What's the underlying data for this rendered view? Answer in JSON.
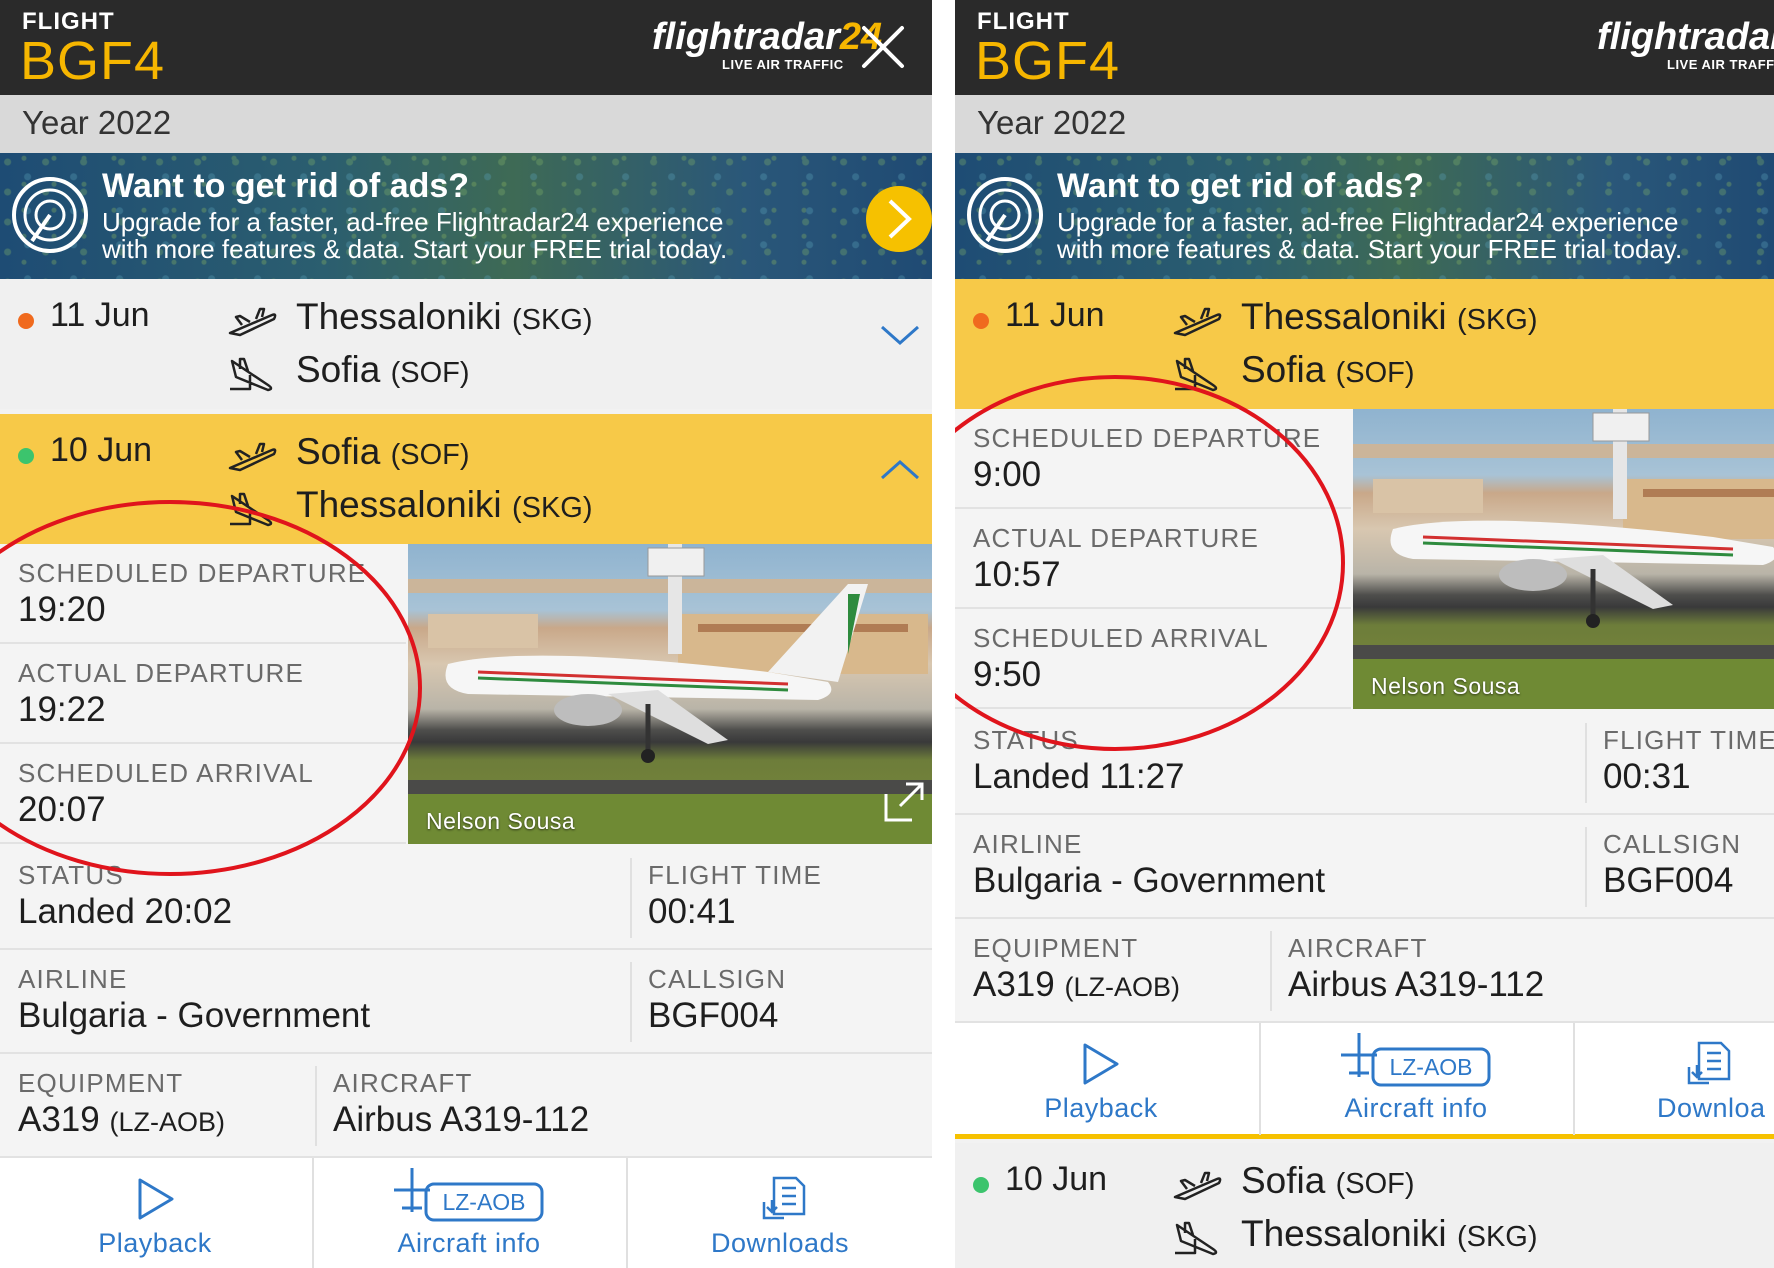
{
  "header": {
    "flight_label": "FLIGHT",
    "flight_code": "BGF4",
    "brand_name": "flightradar",
    "brand_number": "24",
    "brand_tagline": "LIVE AIR TRAFFIC"
  },
  "year_label": "Year 2022",
  "ad": {
    "title": "Want to get rid of ads?",
    "line1": "Upgrade for a faster, ad-free Flightradar24 experience",
    "line2": "with more features & data. Start your FREE trial today."
  },
  "flights": [
    {
      "date": "11 Jun",
      "status_color": "#f06a1e",
      "from_city": "Thessaloniki",
      "from_code": "(SKG)",
      "to_city": "Sofia",
      "to_code": "(SOF)",
      "scheduled_departure_label": "SCHEDULED DEPARTURE",
      "scheduled_departure": "9:00",
      "actual_departure_label": "ACTUAL DEPARTURE",
      "actual_departure": "10:57",
      "scheduled_arrival_label": "SCHEDULED ARRIVAL",
      "scheduled_arrival": "9:50",
      "status_label": "STATUS",
      "status": "Landed 11:27",
      "flight_time_label": "FLIGHT TIME",
      "flight_time": "00:31"
    },
    {
      "date": "10 Jun",
      "status_color": "#3cc46d",
      "from_city": "Sofia",
      "from_code": "(SOF)",
      "to_city": "Thessaloniki",
      "to_code": "(SKG)",
      "scheduled_departure_label": "SCHEDULED DEPARTURE",
      "scheduled_departure": "19:20",
      "actual_departure_label": "ACTUAL DEPARTURE",
      "actual_departure": "19:22",
      "scheduled_arrival_label": "SCHEDULED ARRIVAL",
      "scheduled_arrival": "20:07",
      "status_label": "STATUS",
      "status": "Landed 20:02",
      "flight_time_label": "FLIGHT TIME",
      "flight_time": "00:41"
    }
  ],
  "common": {
    "airline_label": "AIRLINE",
    "airline": "Bulgaria - Government",
    "callsign_label": "CALLSIGN",
    "callsign": "BGF004",
    "equipment_label": "EQUIPMENT",
    "equipment": "A319",
    "equipment_reg": "(LZ-AOB)",
    "aircraft_label": "AIRCRAFT",
    "aircraft": "Airbus A319-112",
    "photo_credit": "Nelson Sousa",
    "registration_badge": "LZ-AOB"
  },
  "actions": {
    "playback": "Playback",
    "aircraft_info": "Aircraft info",
    "downloads": "Downloads",
    "downloads_clipped": "Downloa"
  },
  "colors": {
    "header_bg": "#2a2a2a",
    "accent_yellow": "#f6b600",
    "active_row": "#f7c948",
    "link_blue": "#2e78c8",
    "annotation_red": "#e0141c"
  },
  "icons": [
    "close-icon",
    "radar-icon",
    "chevron-right-icon",
    "takeoff-icon",
    "landing-icon",
    "chevron-down-icon",
    "chevron-up-icon",
    "expand-icon",
    "play-icon",
    "aircraft-badge-icon",
    "download-icon"
  ]
}
